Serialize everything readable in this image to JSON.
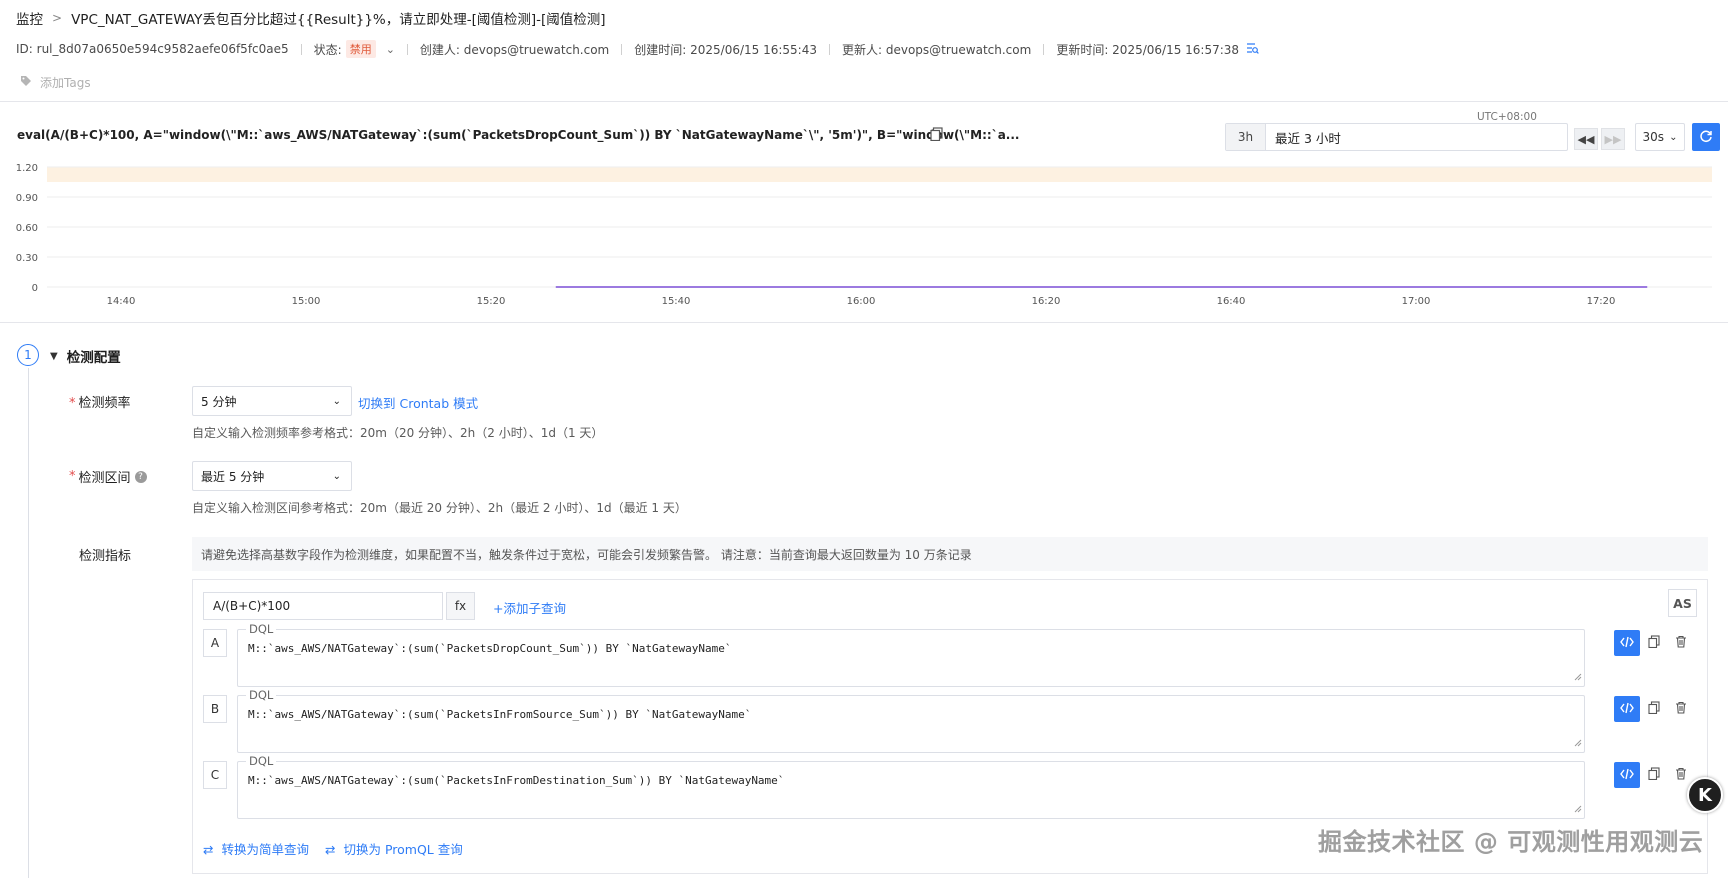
{
  "header": {
    "breadcrumb_root": "监控",
    "title": "VPC_NAT_GATEWAY丢包百分比超过{{Result}}%，请立即处理-[阈值检测]-[阈值检测]",
    "id_text": "ID: rul_8d07a0650e594c9582aefe06f5fc0ae5",
    "status_label": "状态:",
    "status_value": "禁用",
    "creator": "创建人: devops@truewatch.com",
    "created_at": "创建时间: 2025/06/15 16:55:43",
    "updater": "更新人: devops@truewatch.com",
    "updated_at": "更新时间: 2025/06/15 16:57:38",
    "add_tags": "添加Tags"
  },
  "query_bar": {
    "query_text": "eval(A/(B+C)*100, A=\"window(\\\"M::`aws_AWS/NATGateway`:(sum(`PacketsDropCount_Sum`)) BY `NatGatewayName`\\\", '5m')\", B=\"window(\\\"M::`a...",
    "timezone": "UTC+08:00",
    "range_preset": "3h",
    "range_text": "最近 3 小时",
    "interval": "30s"
  },
  "chart_data": {
    "type": "line",
    "y_ticks": [
      "1.20",
      "0.90",
      "0.60",
      "0.30",
      "0"
    ],
    "ylim": [
      0,
      1.2
    ],
    "x_ticks": [
      "14:40",
      "15:00",
      "15:20",
      "15:40",
      "16:00",
      "16:20",
      "16:40",
      "17:00",
      "17:20"
    ],
    "threshold_band": [
      1.05,
      1.2
    ],
    "series_color": "#7b4fd6",
    "band_color": "#fdf1e1",
    "series": [
      {
        "x": [
          "15:27",
          "17:25"
        ],
        "values": [
          0,
          0
        ]
      }
    ]
  },
  "section": {
    "step_number": "1",
    "title": "检测配置",
    "freq_label": "检测频率",
    "freq_value": "5 分钟",
    "crontab_link": "切换到 Crontab 模式",
    "freq_hint": "自定义输入检测频率参考格式：20m（20 分钟）、2h（2 小时）、1d（1 天）",
    "range_label": "检测区间",
    "range_value": "最近 5 分钟",
    "range_hint": "自定义输入检测区间参考格式：20m（最近 20 分钟）、2h（最近 2 小时）、1d（最近 1 天）",
    "metric_label": "检测指标",
    "metric_info": "请避免选择高基数字段作为检测维度，如果配置不当，触发条件过于宽松，可能会引发频繁告警。 请注意：当前查询最大返回数量为 10 万条记录",
    "expression": "A/(B+C)*100",
    "fx_label": "fx",
    "add_subquery": "添加子查询",
    "as_label": "AS",
    "queries": [
      {
        "letter": "A",
        "type": "DQL",
        "text": "M::`aws_AWS/NATGateway`:(sum(`PacketsDropCount_Sum`)) BY `NatGatewayName`"
      },
      {
        "letter": "B",
        "type": "DQL",
        "text": "M::`aws_AWS/NATGateway`:(sum(`PacketsInFromSource_Sum`)) BY `NatGatewayName`"
      },
      {
        "letter": "C",
        "type": "DQL",
        "text": "M::`aws_AWS/NATGateway`:(sum(`PacketsInFromDestination_Sum`)) BY `NatGatewayName`"
      }
    ],
    "convert_simple": "转换为简单查询",
    "switch_promql": "切换为 PromQL 查询"
  },
  "watermark": "掘金技术社区 @ 可观测性用观测云",
  "logo_letter": "K"
}
